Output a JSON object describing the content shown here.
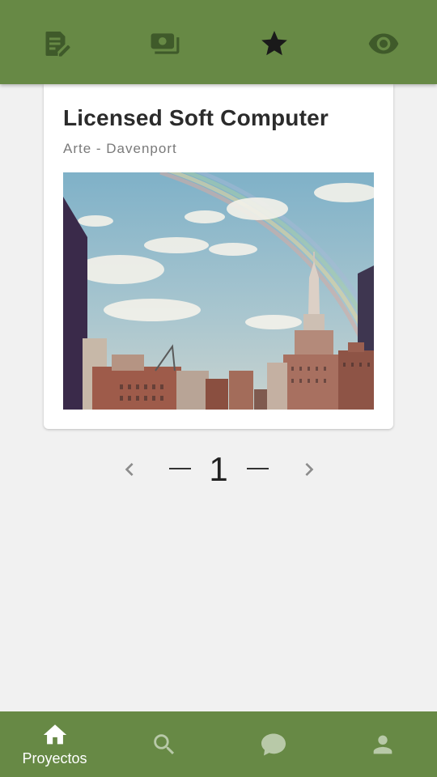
{
  "top_tabs": [
    {
      "name": "edit-document",
      "icon": "edit-note-icon",
      "active": false
    },
    {
      "name": "money",
      "icon": "money-icon",
      "active": false
    },
    {
      "name": "favorites",
      "icon": "star-icon",
      "active": true
    },
    {
      "name": "views",
      "icon": "eye-icon",
      "active": false
    }
  ],
  "card": {
    "title": "Licensed Soft Computer",
    "subtitle": "Arte - Davenport",
    "image": "city-skyline-rainbow-photo"
  },
  "pager": {
    "current_page": "1",
    "prev_icon": "chevron-left-icon",
    "next_icon": "chevron-right-icon"
  },
  "bottom_nav": {
    "items": [
      {
        "label": "Proyectos",
        "icon": "home-icon",
        "active": true
      },
      {
        "label": "",
        "icon": "search-icon",
        "active": false
      },
      {
        "label": "",
        "icon": "chat-icon",
        "active": false
      },
      {
        "label": "",
        "icon": "person-icon",
        "active": false
      }
    ]
  },
  "colors": {
    "bar": "#678945",
    "icon_inactive": "#3f5a2a",
    "icon_active": "#1a1a1a",
    "bottom_inactive": "#b8c9a8",
    "bottom_active": "#ffffff",
    "background": "#f1f1f1"
  }
}
